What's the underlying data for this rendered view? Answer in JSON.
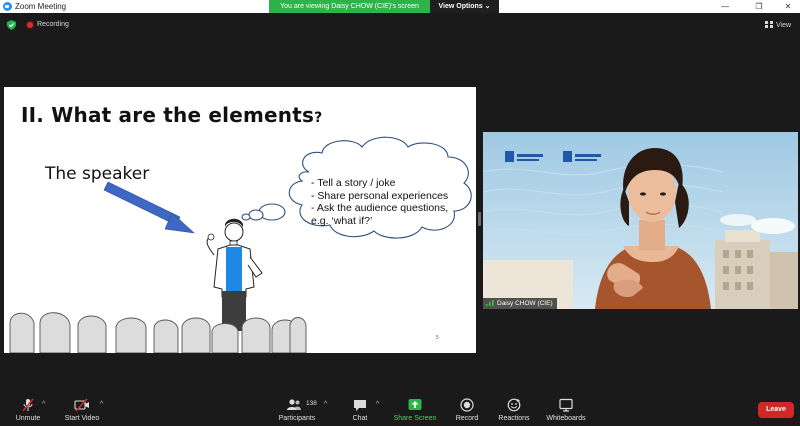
{
  "window": {
    "title": "Zoom Meeting",
    "minimize": "—",
    "restore": "❐",
    "close": "✕"
  },
  "share_banner": {
    "text_prefix": "You are viewing",
    "presenter": "Daisy CHOW (CIE)'s screen",
    "view_options": "View Options ⌄"
  },
  "status": {
    "recording": "Recording",
    "view": "View"
  },
  "slide": {
    "title": "II. What are the elements",
    "title_suffix": "?",
    "speaker_label": "The speaker",
    "bubble_lines": [
      "- Tell a story / joke",
      "- Share personal experiences",
      "- Ask the audience questions,",
      "  e.g. ‘what if?’"
    ],
    "page_number": "5"
  },
  "video": {
    "participant_name": "Daisy CHOW (CIE)"
  },
  "toolbar": {
    "unmute": "Unmute",
    "start_video": "Start Video",
    "participants": "Participants",
    "participant_count": "138",
    "chat": "Chat",
    "share_screen": "Share Screen",
    "record": "Record",
    "reactions": "Reactions",
    "whiteboards": "Whiteboards",
    "leave": "Leave",
    "caret": "^"
  },
  "colors": {
    "share_green": "#2db34a",
    "leave_red": "#d32626",
    "zoom_blue": "#2d8cff",
    "speaker_shirt": "#1e88e5",
    "arrow_blue": "#3f67c4"
  }
}
